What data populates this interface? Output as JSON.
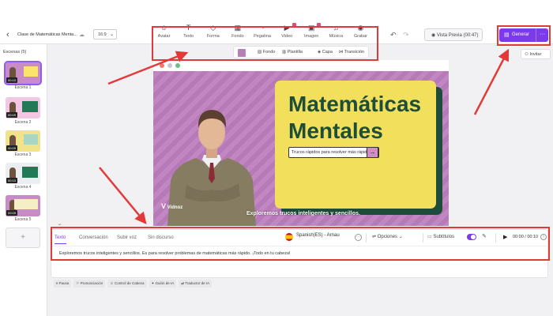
{
  "header": {
    "back": "‹",
    "project_title": "Clase de Matemáticas Menta...",
    "aspect_ratio": "16:9",
    "tools": [
      {
        "label": "Avatar",
        "icon": "avatar-icon",
        "glyph": "☺"
      },
      {
        "label": "Texto",
        "icon": "text-icon",
        "glyph": "T"
      },
      {
        "label": "Forma",
        "icon": "shape-icon",
        "glyph": "◇"
      },
      {
        "label": "Fondo",
        "icon": "background-icon",
        "glyph": "▦"
      },
      {
        "label": "Pegatina",
        "icon": "sticker-icon",
        "glyph": "◔"
      },
      {
        "label": "Video",
        "icon": "video-icon",
        "glyph": "▶"
      },
      {
        "label": "Imagen",
        "icon": "image-icon",
        "glyph": "▣"
      },
      {
        "label": "Música",
        "icon": "music-icon",
        "glyph": "♫"
      },
      {
        "label": "Grabar",
        "icon": "record-icon",
        "glyph": "◉"
      }
    ],
    "preview_label": "Vista Previa (00:47)",
    "generate_label": "Generar",
    "invite_label": "Invitar"
  },
  "scene_toolbar": {
    "swatch_color": "#b77fb5",
    "items": [
      "Fondo",
      "Plantilla",
      "Capa",
      "Transición"
    ]
  },
  "sidebar": {
    "title": "Escenas (5)",
    "scenes": [
      {
        "label": "Escena 1",
        "duration": "00:10"
      },
      {
        "label": "Escena 2",
        "duration": "00:09"
      },
      {
        "label": "Escena 3",
        "duration": "00:09"
      },
      {
        "label": "Escena 4",
        "duration": "00:10"
      },
      {
        "label": "Escena 5",
        "duration": "00:09"
      }
    ]
  },
  "slide": {
    "title_line1": "Matemáticas",
    "title_line2": "Mentales",
    "pill_text": "Trucos rápidos para resolver más rápido",
    "pill_arrow": "→",
    "subtitle": "Exploremos trucos inteligentes y sencillos.",
    "logo_text": "Vidnoz",
    "background_color": "#bd7ebe",
    "card_color": "#f2df5b",
    "title_color": "#1e4d38"
  },
  "editor": {
    "tabs": [
      "Texto",
      "Conversación",
      "Subir voz",
      "Sin discurso"
    ],
    "active_tab": "Texto",
    "voice": "Spanish(ES) - Arnau",
    "options_label": "Opciones",
    "subtitles_label": "Subtítulos",
    "time": "00:00 / 00:10",
    "script": "Exploremos trucos inteligentes y sencillos. Es para resolver problemas de matemáticas más rápido. ¡Todo en tu cabeza!"
  },
  "chips": [
    "Pausa",
    "Pronunciación",
    "Control de Cabeza",
    "Guión de IA",
    "Traductor de IA"
  ],
  "colors": {
    "accent": "#7c3aed",
    "highlight": "#e23a3a"
  }
}
